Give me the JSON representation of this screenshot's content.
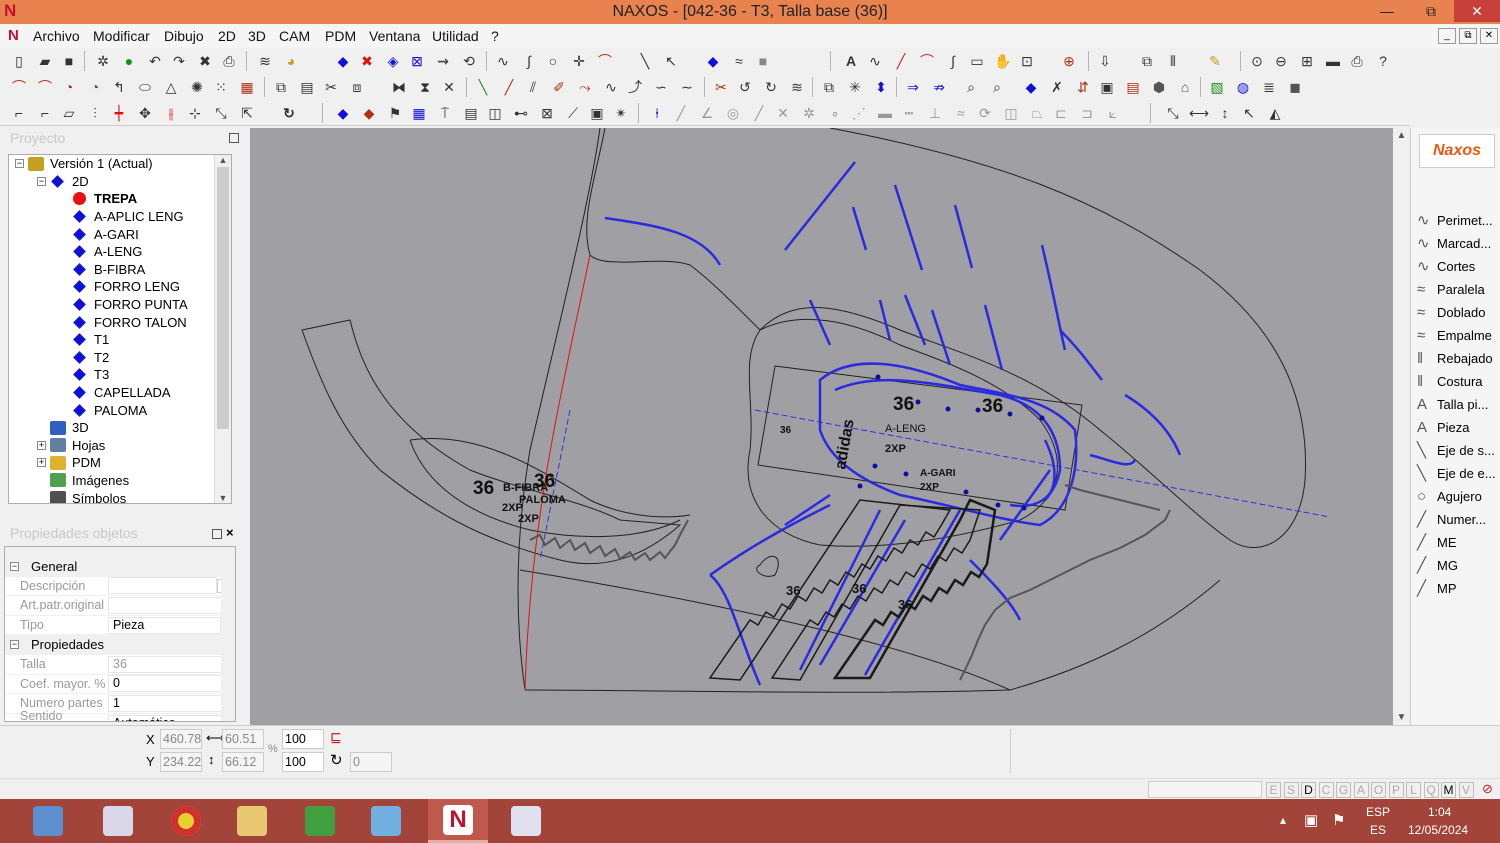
{
  "window": {
    "title": "NAXOS - [042-36 - T3, Talla base (36)]",
    "logo": "N",
    "min_label": "—",
    "max_label": "⧉",
    "close_label": "✕"
  },
  "menu": [
    "Archivo",
    "Modificar",
    "Dibujo",
    "2D",
    "3D",
    "CAM",
    "PDM",
    "Ventana",
    "Utilidad",
    "?"
  ],
  "mdi_controls": [
    "_",
    "⧉",
    "✕"
  ],
  "project_panel": {
    "title": "Proyecto"
  },
  "tree": [
    {
      "label": "Versión 1 (Actual)",
      "indent": 0,
      "icon": "version-icon",
      "expand": "−"
    },
    {
      "label": "2D",
      "indent": 1,
      "icon": "diamond",
      "expand": "−"
    },
    {
      "label": "TREPA",
      "indent": 2,
      "icon": "dot",
      "bold": true
    },
    {
      "label": "A-APLIC LENG",
      "indent": 2,
      "icon": "diamond"
    },
    {
      "label": "A-GARI",
      "indent": 2,
      "icon": "diamond"
    },
    {
      "label": "A-LENG",
      "indent": 2,
      "icon": "diamond"
    },
    {
      "label": "B-FIBRA",
      "indent": 2,
      "icon": "diamond"
    },
    {
      "label": "FORRO LENG",
      "indent": 2,
      "icon": "diamond"
    },
    {
      "label": "FORRO PUNTA",
      "indent": 2,
      "icon": "diamond"
    },
    {
      "label": "FORRO TALON",
      "indent": 2,
      "icon": "diamond"
    },
    {
      "label": "T1",
      "indent": 2,
      "icon": "diamond"
    },
    {
      "label": "T2",
      "indent": 2,
      "icon": "diamond"
    },
    {
      "label": "T3",
      "indent": 2,
      "icon": "diamond"
    },
    {
      "label": "CAPELLADA",
      "indent": 2,
      "icon": "diamond"
    },
    {
      "label": "PALOMA",
      "indent": 2,
      "icon": "diamond"
    },
    {
      "label": "3D",
      "indent": 1,
      "icon": "3d"
    },
    {
      "label": "Hojas",
      "indent": 1,
      "icon": "sheets",
      "expand": "+"
    },
    {
      "label": "PDM",
      "indent": 1,
      "icon": "folder",
      "expand": "+"
    },
    {
      "label": "Imágenes",
      "indent": 1,
      "icon": "images"
    },
    {
      "label": "Símbolos",
      "indent": 1,
      "icon": "symbols"
    }
  ],
  "props_panel": {
    "title": "Propiedades objetos"
  },
  "props": [
    {
      "group": "General"
    },
    {
      "label": "Descripción",
      "value": "",
      "button": "..."
    },
    {
      "label": "Art.patr.original",
      "value": ""
    },
    {
      "label": "Tipo",
      "value": "Pieza",
      "dropdown": true
    },
    {
      "group": "Propiedades"
    },
    {
      "label": "Talla",
      "value": "36",
      "grey": true
    },
    {
      "label": "Coef. mayor. %",
      "value": "0"
    },
    {
      "label": "Numero partes",
      "value": "1"
    },
    {
      "label": "Sentido perímetr",
      "value": "Automático"
    }
  ],
  "right_logo": "Naxos",
  "right_tools": [
    "Perimet...",
    "Marcad...",
    "Cortes",
    "Paralela",
    "Doblado",
    "Empalme",
    "Rebajado",
    "Costura",
    "Talla pi...",
    "Pieza",
    "Eje de s...",
    "Eje de e...",
    "Agujero",
    "Numer...",
    "ME",
    "MG",
    "MP"
  ],
  "right_tool_icons": [
    "∿",
    "∿",
    "∿",
    "≈",
    "≈",
    "≈",
    "‖",
    "‖",
    "A",
    "A",
    "╲",
    "╲",
    "○",
    "╱",
    "╱",
    "╱",
    "╱"
  ],
  "coords": {
    "x_label": "X",
    "y_label": "Y",
    "x": "460.78",
    "y": "234.22",
    "w": "60.51",
    "h": "66.12",
    "sx": "100",
    "sy": "100",
    "angle": "0",
    "pct": "%"
  },
  "snap_modes": [
    "E",
    "S",
    "D",
    "C",
    "G",
    "A",
    "O",
    "P",
    "L",
    "Q",
    "M",
    "V"
  ],
  "drawing": {
    "labels": [
      "36",
      "36",
      "36",
      "36",
      "36",
      "36",
      "36",
      "36"
    ],
    "texts": [
      "B-FIBRA",
      "PALOMA",
      "2XP",
      "2XP",
      "A-LENG",
      "2XP",
      "A-GARI",
      "2XP",
      "adidas",
      "36"
    ]
  },
  "taskbar": {
    "lang_top": "ESP",
    "lang_bottom": "ES",
    "time": "1:04",
    "date": "12/05/2024"
  }
}
